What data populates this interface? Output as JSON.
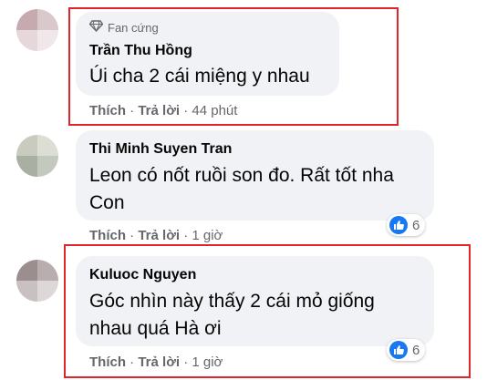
{
  "comments": [
    {
      "badge": "Fan cứng",
      "author": "Trần Thu Hồng",
      "lines": [
        "Úi cha 2 cái miệng y nhau"
      ],
      "like": "Thích",
      "reply": "Trả lời",
      "time": "44 phút",
      "reactions": null
    },
    {
      "author": "Thi Minh Suyen Tran",
      "lines": [
        "Leon có nốt ruồi son đo. Rất tốt nha",
        "Con"
      ],
      "like": "Thích",
      "reply": "Trả lời",
      "time": "1 giờ",
      "reactions": "6"
    },
    {
      "author": "Kuluoc Nguyen",
      "lines": [
        "Góc nhìn này thấy 2 cái mỏ giống",
        "nhau quá Hà ơi"
      ],
      "like": "Thích",
      "reply": "Trả lời",
      "time": "1 giờ",
      "reactions": "6"
    }
  ],
  "colors": {
    "highlight": "#e0242a",
    "bubble": "#f0f2f5",
    "like": "#1877f2"
  },
  "icons": {
    "badge": "diamond-icon",
    "reaction": "thumbs-up-icon"
  }
}
